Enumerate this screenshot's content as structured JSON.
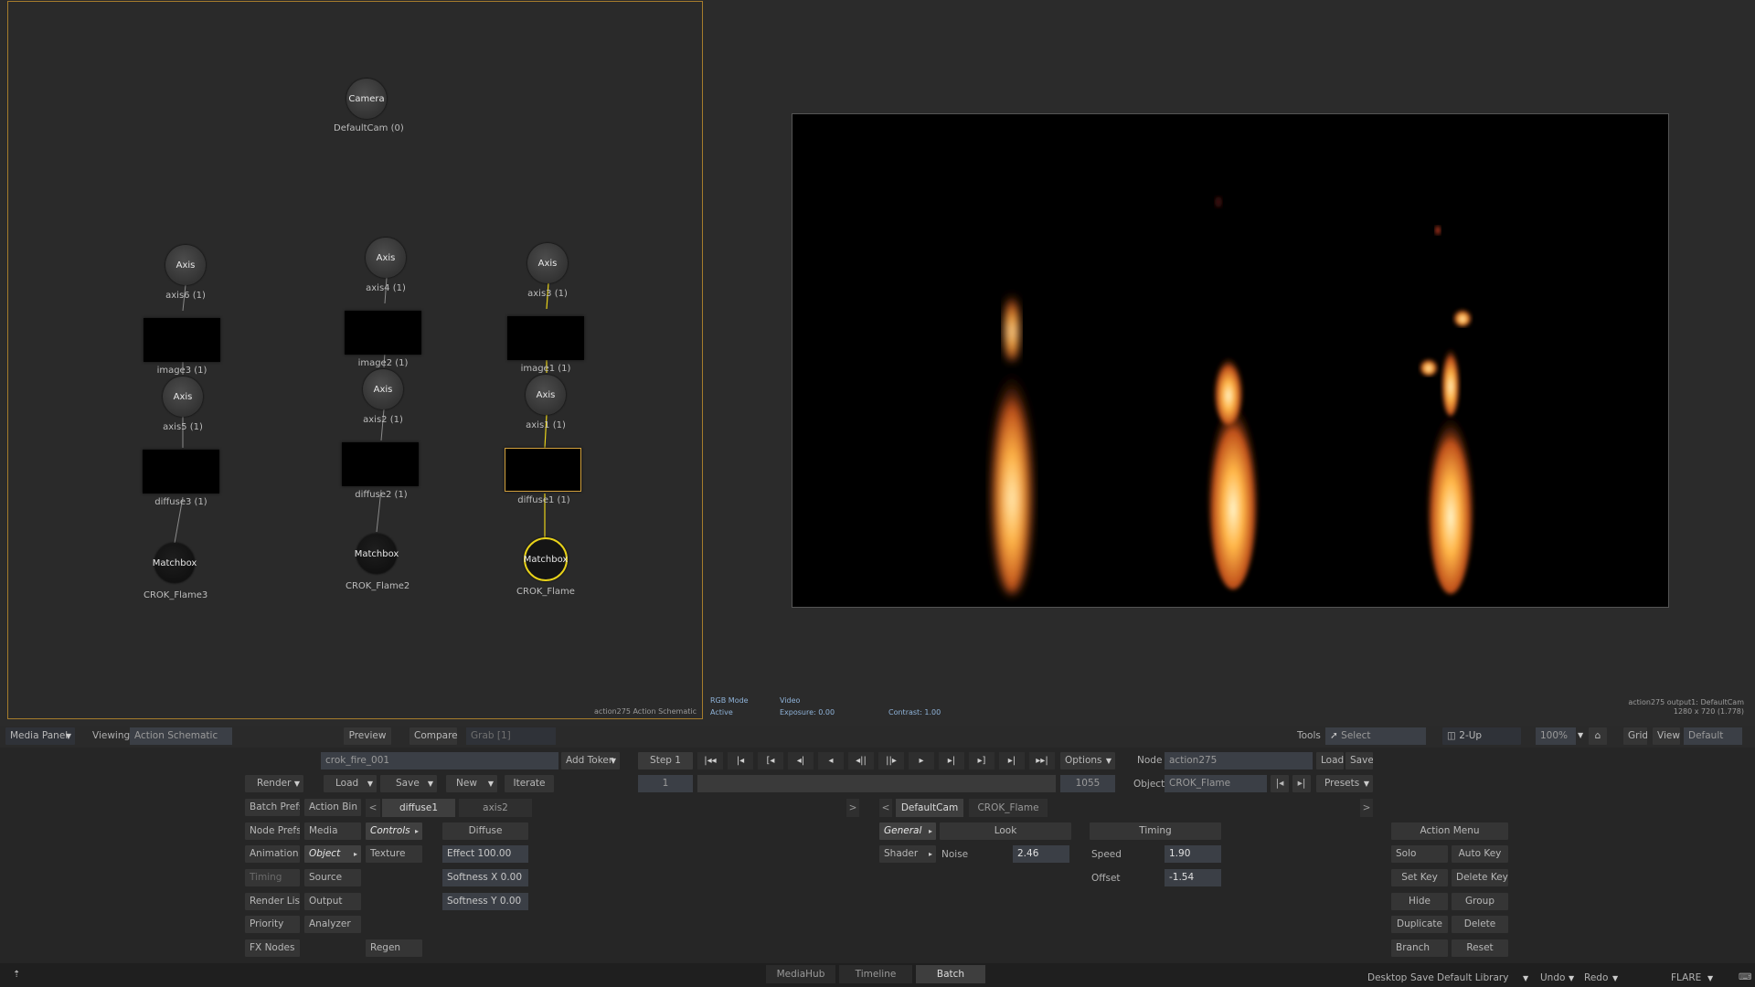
{
  "schematic": {
    "footer": "action275 Action Schematic",
    "nodes": {
      "camera": {
        "title": "Camera",
        "label": "DefaultCam (0)"
      },
      "axis6": {
        "title": "Axis",
        "label": "axis6 (1)"
      },
      "axis4": {
        "title": "Axis",
        "label": "axis4 (1)"
      },
      "axis3": {
        "title": "Axis",
        "label": "axis3 (1)"
      },
      "image3": {
        "label": "image3 (1)"
      },
      "image2": {
        "label": "image2 (1)"
      },
      "image1": {
        "label": "image1 (1)"
      },
      "axis5": {
        "title": "Axis",
        "label": "axis5 (1)"
      },
      "axis2b": {
        "title": "Axis",
        "label": "axis2 (1)"
      },
      "axis1": {
        "title": "Axis",
        "label": "axis1 (1)"
      },
      "diffuse3": {
        "label": "diffuse3 (1)"
      },
      "diffuse2": {
        "label": "diffuse2 (1)"
      },
      "diffuse1": {
        "label": "diffuse1 (1)"
      },
      "mb3": {
        "title": "Matchbox",
        "label": "CROK_Flame3"
      },
      "mb2": {
        "title": "Matchbox",
        "label": "CROK_Flame2"
      },
      "mb1": {
        "title": "Matchbox",
        "label": "CROK_Flame"
      }
    }
  },
  "viewer": {
    "rgb_mode": "RGB Mode",
    "active": "Active",
    "video": "Video",
    "exposure": "Exposure: 0.00",
    "contrast": "Contrast: 1.00",
    "output": "action275 output1: DefaultCam",
    "res": "1280 x 720 (1.778)"
  },
  "viewbar": {
    "media_panel": "Media Panel",
    "viewing": "Viewing",
    "viewing_value": "Action Schematic",
    "preview": "Preview",
    "compare": "Compare",
    "grab": "Grab [1]",
    "tools": "Tools",
    "select": "Select",
    "twoup": "2-Up",
    "zoom": "100%",
    "grid": "Grid",
    "view": "View",
    "default": "Default"
  },
  "controls": {
    "setup_name": "crok_fire_001",
    "add_token": "Add Token",
    "render": "Render",
    "load": "Load",
    "save": "Save",
    "new": "New",
    "iterate": "Iterate",
    "step": "Step 1",
    "frame": "1",
    "end_frame": "1055",
    "options": "Options",
    "node_lbl": "Node",
    "node_value": "action275",
    "node_load": "Load",
    "node_save": "Save",
    "object_lbl": "Object",
    "object_value": "CROK_Flame",
    "presets": "Presets",
    "left_col": [
      "Batch Prefs",
      "Node Prefs",
      "Animation",
      "Timing",
      "Render List",
      "Priority",
      "FX Nodes"
    ],
    "mid_col": [
      "Action Bin",
      "Media",
      "Object",
      "Source",
      "Output",
      "Analyzer"
    ],
    "controls": "Controls",
    "texture": "Texture",
    "regen": "Regen",
    "tab_diffuse1": "diffuse1",
    "tab_axis2": "axis2",
    "diffuse_hdr": "Diffuse",
    "effect": "Effect 100.00",
    "softx": "Softness X 0.00",
    "softy": "Softness Y 0.00",
    "tab_defaultcam": "DefaultCam",
    "tab_crok": "CROK_Flame",
    "general": "General",
    "look": "Look",
    "shader": "Shader",
    "noise": "Noise",
    "noise_val": "2.46",
    "timing_hdr": "Timing",
    "speed": "Speed",
    "speed_val": "1.90",
    "offset": "Offset",
    "offset_val": "-1.54",
    "action_menu": "Action Menu",
    "am_left": [
      "Solo",
      "Set Key",
      "Hide",
      "Duplicate",
      "Branch"
    ],
    "am_right": [
      "Auto Key",
      "Delete Key",
      "Group",
      "Delete",
      "Reset"
    ]
  },
  "bottom": {
    "tabs": [
      "MediaHub",
      "Timeline",
      "Batch"
    ],
    "desktop": "Desktop",
    "save": "Save",
    "library": "Default Library",
    "undo": "Undo",
    "redo": "Redo",
    "flare": "FLARE"
  },
  "colors": {
    "selection": "#e8d21a",
    "accent": "#e8a13a",
    "schematic_border": "#a67c2c"
  }
}
